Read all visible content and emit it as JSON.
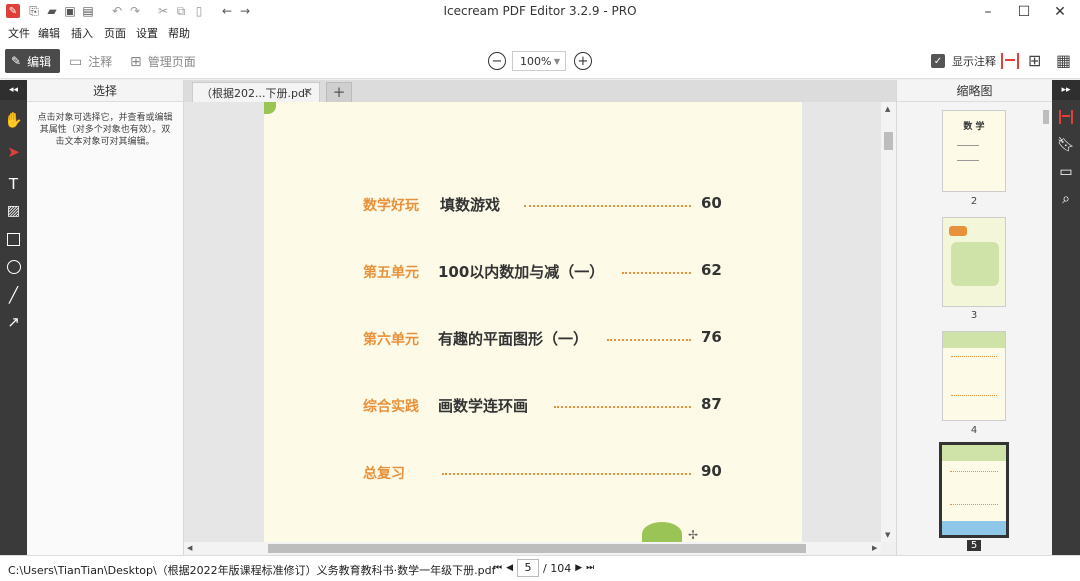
{
  "window": {
    "title": "Icecream PDF Editor 3.2.9 - PRO"
  },
  "menu": [
    "文件",
    "编辑",
    "插入",
    "页面",
    "设置",
    "帮助"
  ],
  "toolbar": {
    "mode_edit": "编辑",
    "mode_annotate": "注释",
    "mode_manage": "管理页面",
    "zoom": "100%",
    "show_annotations": "显示注释",
    "show_annotations_checked": true
  },
  "left_panel": {
    "header": "选择",
    "hint": "点击对象可选择它，并查看或编辑其属性（对多个对象也有效）。双击文本对象可对其编辑。"
  },
  "tab": {
    "label": "（根据202...下册.pdf",
    "close": "✕"
  },
  "toc": [
    {
      "unit": "数学好玩",
      "title": "填数游戏",
      "page": "60"
    },
    {
      "unit": "第五单元",
      "title": "100以内数加与减（一）",
      "page": "62"
    },
    {
      "unit": "第六单元",
      "title": "有趣的平面图形（一）",
      "page": "76"
    },
    {
      "unit": "综合实践",
      "title": "画数学连环画",
      "page": "87"
    },
    {
      "unit": "",
      "title": "总复习",
      "page": "90"
    }
  ],
  "thumbnails": {
    "header": "缩略图",
    "pages": [
      {
        "number": "2",
        "title": "数 学"
      },
      {
        "number": "3"
      },
      {
        "number": "4"
      },
      {
        "number": "5",
        "selected": true
      }
    ]
  },
  "status": {
    "path": "C:\\Users\\TianTian\\Desktop\\（根据2022年版课程标准修订）义务教育教科书·数学一年级下册.pdf",
    "current_page": "5",
    "total_pages": "/ 104"
  },
  "colors": {
    "accent": "#e8913a",
    "strip": "#3a3a3a",
    "highlight": "#e0403a"
  }
}
